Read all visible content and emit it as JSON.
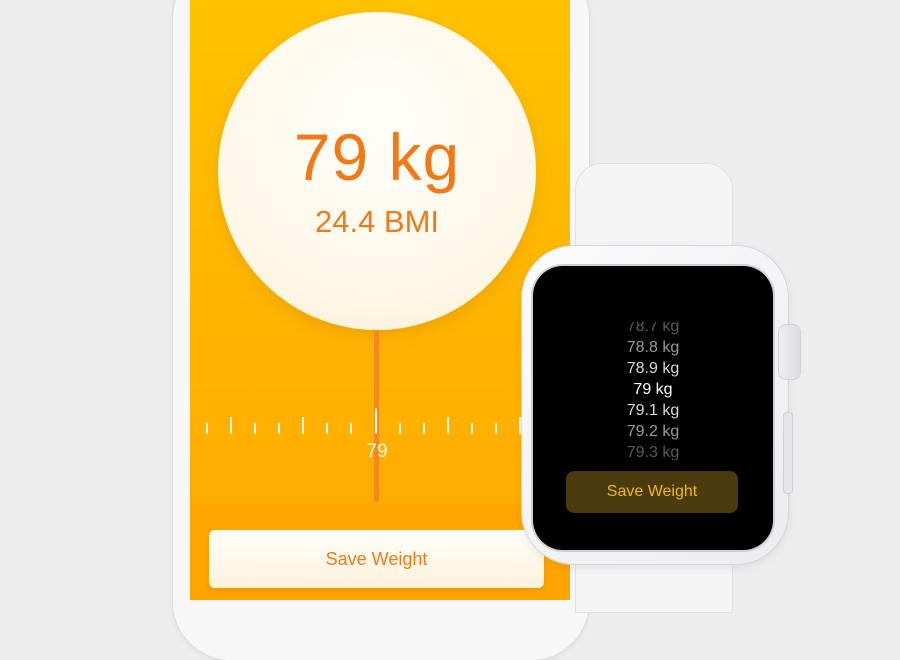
{
  "phone": {
    "weight": "79 kg",
    "bmi": "24.4 BMI",
    "ruler_label": "79",
    "save_button": "Save Weight"
  },
  "watch": {
    "picker_items": [
      "78.7 kg",
      "78.8 kg",
      "78.9 kg",
      "79 kg",
      "79.1 kg",
      "79.2 kg",
      "79.3 kg"
    ],
    "selected_index": 3,
    "save_button": "Save Weight"
  },
  "colors": {
    "accent_orange": "#f07a18",
    "screen_yellow": "#ffb400",
    "watch_button_bg": "#4a3a0d",
    "watch_button_text": "#f2b90f"
  }
}
